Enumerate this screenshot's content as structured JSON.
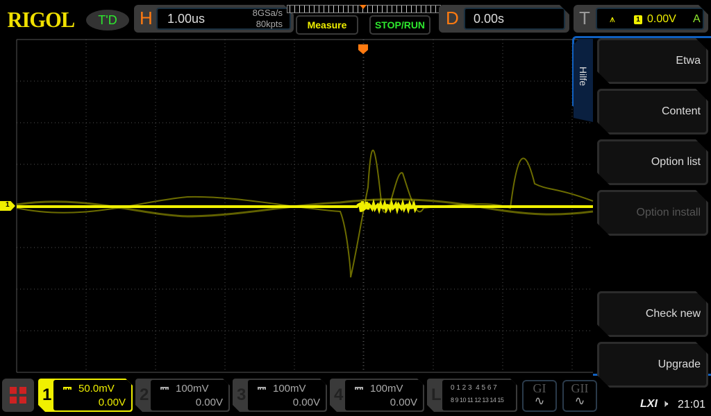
{
  "header": {
    "logo": "RIGOL",
    "status": "T'D",
    "horizontal": {
      "label": "H",
      "timebase": "1.00us",
      "sample_rate": "8GSa/s",
      "memory_depth": "80kpts"
    },
    "measure_label": "Measure",
    "stop_run_label": "STOP/RUN",
    "delay": {
      "label": "D",
      "value": "0.00s"
    },
    "trigger": {
      "label": "T",
      "source": "1",
      "level": "0.00V",
      "mode": "A"
    }
  },
  "side_menu": {
    "title": "Hilfe",
    "items": [
      {
        "label": "Etwa",
        "enabled": true
      },
      {
        "label": "Content",
        "enabled": true
      },
      {
        "label": "Option list",
        "enabled": true
      },
      {
        "label": "Option install",
        "enabled": false
      },
      {
        "label": "Check new",
        "enabled": true
      },
      {
        "label": "Upgrade",
        "enabled": true
      }
    ]
  },
  "channel_marker": "1",
  "channels": [
    {
      "num": "1",
      "scale": "50.0mV",
      "offset": "0.00V",
      "active": true
    },
    {
      "num": "2",
      "scale": "100mV",
      "offset": "0.00V",
      "active": false
    },
    {
      "num": "3",
      "scale": "100mV",
      "offset": "0.00V",
      "active": false
    },
    {
      "num": "4",
      "scale": "100mV",
      "offset": "0.00V",
      "active": false
    }
  ],
  "logic": {
    "label": "L",
    "row1": "0 1 2 3  4 5 6 7",
    "row2": "8 9 10 11 12 13 14 15"
  },
  "gen1": "GI",
  "gen2": "GII",
  "status_bar": {
    "lxi": "LXI",
    "time": "21:01"
  },
  "colors": {
    "ch1": "#f0f000",
    "accent": "#ff7a10",
    "menu_blue": "#1060c0"
  }
}
